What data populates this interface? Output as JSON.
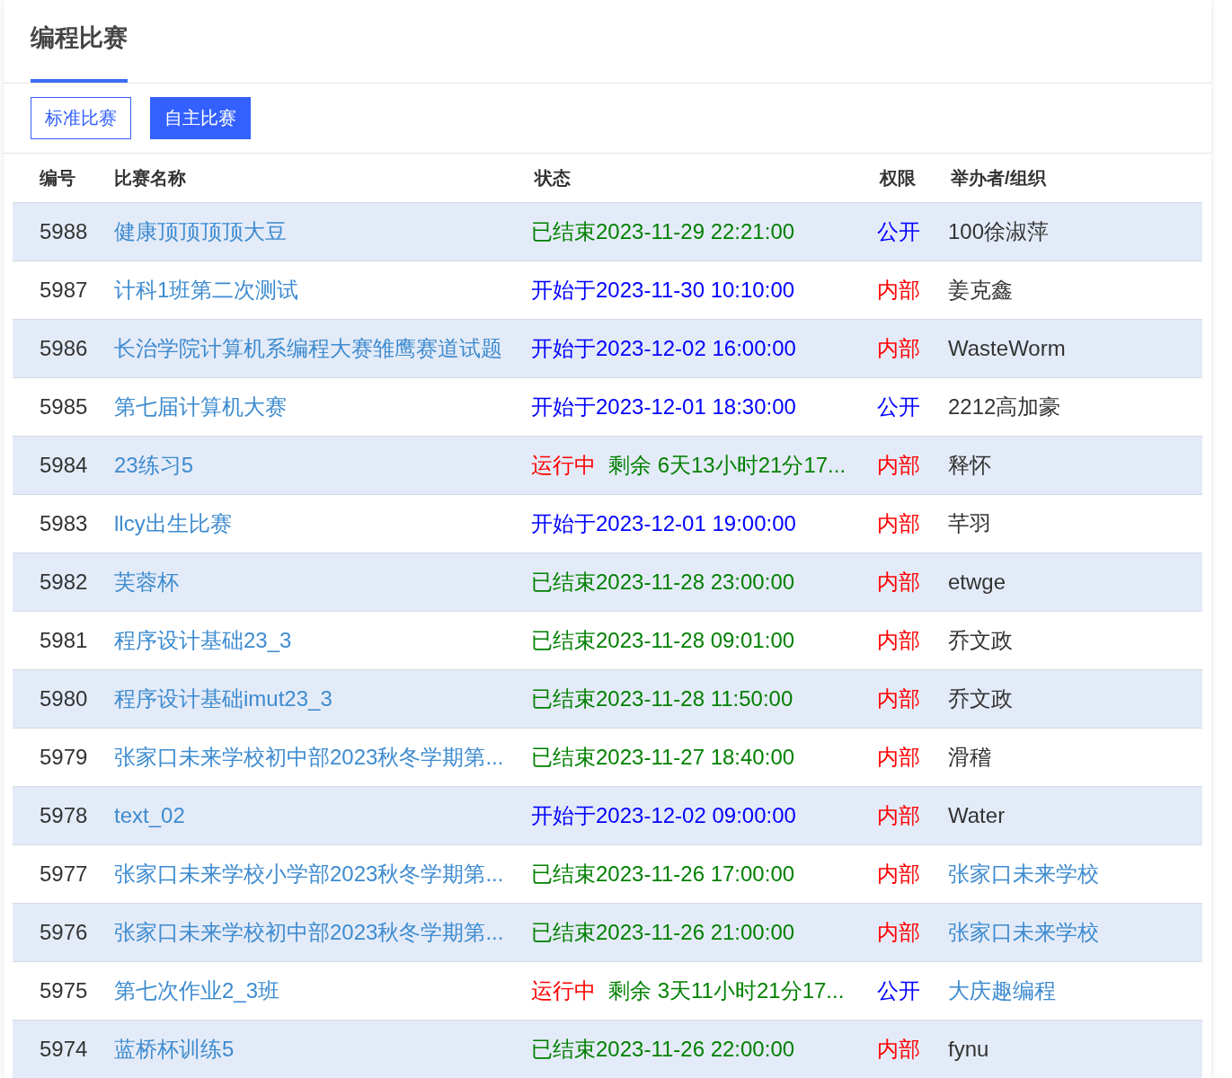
{
  "header": {
    "tabs": [
      {
        "label": "编程比赛",
        "selected": true
      }
    ]
  },
  "filters": [
    {
      "label": "标准比赛",
      "selected": false
    },
    {
      "label": "自主比赛",
      "selected": true
    }
  ],
  "table": {
    "columns": [
      "编号",
      "比赛名称",
      "状态",
      "权限",
      "举办者/组织"
    ],
    "rows": [
      {
        "id": "5988",
        "name": "健康顶顶顶顶大豆",
        "status": {
          "kind": "ended",
          "text": "已结束2023-11-29 22:21:00"
        },
        "access": {
          "kind": "public",
          "label": "公开"
        },
        "organizer": {
          "text": "100徐淑萍",
          "link": false
        }
      },
      {
        "id": "5987",
        "name": "计科1班第二次测试",
        "status": {
          "kind": "upcoming",
          "text": "开始于2023-11-30 10:10:00"
        },
        "access": {
          "kind": "internal",
          "label": "内部"
        },
        "organizer": {
          "text": "姜克鑫",
          "link": false
        }
      },
      {
        "id": "5986",
        "name": "长治学院计算机系编程大赛雏鹰赛道试题",
        "status": {
          "kind": "upcoming",
          "text": "开始于2023-12-02 16:00:00"
        },
        "access": {
          "kind": "internal",
          "label": "内部"
        },
        "organizer": {
          "text": "WasteWorm",
          "link": false
        }
      },
      {
        "id": "5985",
        "name": "第七届计算机大赛",
        "status": {
          "kind": "upcoming",
          "text": "开始于2023-12-01 18:30:00"
        },
        "access": {
          "kind": "public",
          "label": "公开"
        },
        "organizer": {
          "text": "2212高加豪",
          "link": false
        }
      },
      {
        "id": "5984",
        "name": "23练习5",
        "status": {
          "kind": "running",
          "text": "运行中",
          "remaining": "剩余 6天13小时21分17..."
        },
        "access": {
          "kind": "internal",
          "label": "内部"
        },
        "organizer": {
          "text": "释怀",
          "link": false
        }
      },
      {
        "id": "5983",
        "name": "llcy出生比赛",
        "status": {
          "kind": "upcoming",
          "text": "开始于2023-12-01 19:00:00"
        },
        "access": {
          "kind": "internal",
          "label": "内部"
        },
        "organizer": {
          "text": "芊羽",
          "link": false
        }
      },
      {
        "id": "5982",
        "name": "芙蓉杯",
        "status": {
          "kind": "ended",
          "text": "已结束2023-11-28 23:00:00"
        },
        "access": {
          "kind": "internal",
          "label": "内部"
        },
        "organizer": {
          "text": "etwge",
          "link": false
        }
      },
      {
        "id": "5981",
        "name": "程序设计基础23_3",
        "status": {
          "kind": "ended",
          "text": "已结束2023-11-28 09:01:00"
        },
        "access": {
          "kind": "internal",
          "label": "内部"
        },
        "organizer": {
          "text": "乔文政",
          "link": false
        }
      },
      {
        "id": "5980",
        "name": "程序设计基础imut23_3",
        "status": {
          "kind": "ended",
          "text": "已结束2023-11-28 11:50:00"
        },
        "access": {
          "kind": "internal",
          "label": "内部"
        },
        "organizer": {
          "text": "乔文政",
          "link": false
        }
      },
      {
        "id": "5979",
        "name": "张家口未来学校初中部2023秋冬学期第...",
        "status": {
          "kind": "ended",
          "text": "已结束2023-11-27 18:40:00"
        },
        "access": {
          "kind": "internal",
          "label": "内部"
        },
        "organizer": {
          "text": "滑稽",
          "link": false
        }
      },
      {
        "id": "5978",
        "name": "text_02",
        "status": {
          "kind": "upcoming",
          "text": "开始于2023-12-02 09:00:00"
        },
        "access": {
          "kind": "internal",
          "label": "内部"
        },
        "organizer": {
          "text": "Water",
          "link": false
        }
      },
      {
        "id": "5977",
        "name": "张家口未来学校小学部2023秋冬学期第...",
        "status": {
          "kind": "ended",
          "text": "已结束2023-11-26 17:00:00"
        },
        "access": {
          "kind": "internal",
          "label": "内部"
        },
        "organizer": {
          "text": "张家口未来学校",
          "link": true
        }
      },
      {
        "id": "5976",
        "name": "张家口未来学校初中部2023秋冬学期第...",
        "status": {
          "kind": "ended",
          "text": "已结束2023-11-26 21:00:00"
        },
        "access": {
          "kind": "internal",
          "label": "内部"
        },
        "organizer": {
          "text": "张家口未来学校",
          "link": true
        }
      },
      {
        "id": "5975",
        "name": "第七次作业2_3班",
        "status": {
          "kind": "running",
          "text": "运行中",
          "remaining": "剩余 3天11小时21分17..."
        },
        "access": {
          "kind": "public",
          "label": "公开"
        },
        "organizer": {
          "text": "大庆趣编程",
          "link": true
        }
      },
      {
        "id": "5974",
        "name": "蓝桥杯训练5",
        "status": {
          "kind": "ended",
          "text": "已结束2023-11-26 22:00:00"
        },
        "access": {
          "kind": "internal",
          "label": "内部"
        },
        "organizer": {
          "text": "fynu",
          "link": false
        }
      }
    ]
  }
}
